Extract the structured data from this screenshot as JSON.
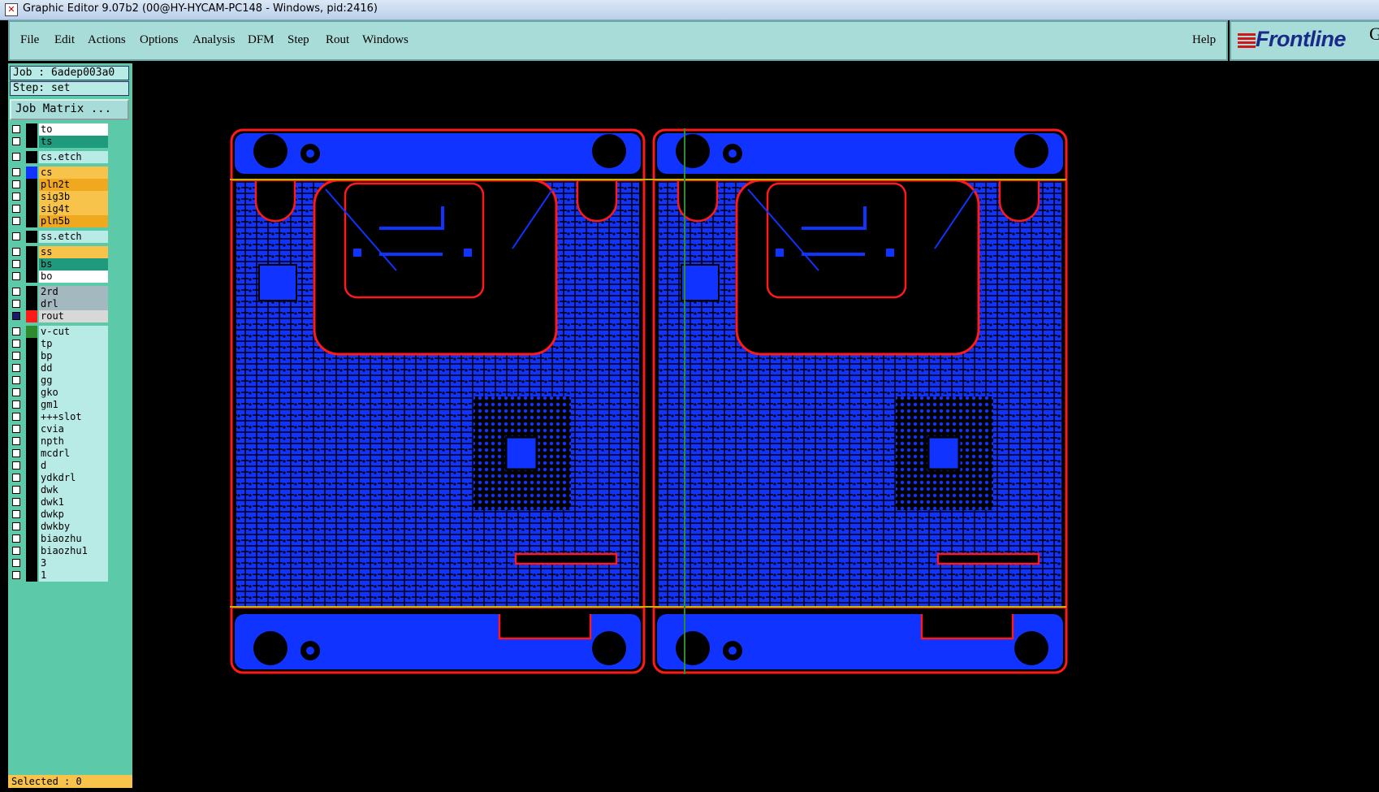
{
  "window": {
    "title": "Graphic Editor 9.07b2 (00@HY-HYCAM-PC148 - Windows, pid:2416)"
  },
  "menu": {
    "items": [
      "File",
      "Edit",
      "Actions",
      "Options",
      "Analysis",
      "DFM",
      "Step",
      "Rout",
      "Windows"
    ],
    "help": "Help"
  },
  "logo": {
    "brand": "Frontline",
    "trailing": "G"
  },
  "job": {
    "job_line": "Job : 6adep003a0",
    "step_line": "Step: set",
    "matrix_button": "Job Matrix ..."
  },
  "layers": [
    {
      "name": "to",
      "bg": "#ffffff",
      "swatch": "#000000"
    },
    {
      "name": "ts",
      "bg": "#1f9a7c",
      "swatch": "#000000"
    },
    {
      "name": "cs.etch",
      "bg": "#b8eae6",
      "swatch": "#000000"
    },
    {
      "name": "cs",
      "bg": "#f7c34a",
      "swatch": "#1033ff"
    },
    {
      "name": "pln2t",
      "bg": "#f0a81e",
      "swatch": "#000000"
    },
    {
      "name": "sig3b",
      "bg": "#f7c34a",
      "swatch": "#000000"
    },
    {
      "name": "sig4t",
      "bg": "#f7c34a",
      "swatch": "#000000"
    },
    {
      "name": "pln5b",
      "bg": "#f0a81e",
      "swatch": "#000000"
    },
    {
      "name": "ss.etch",
      "bg": "#b8eae6",
      "swatch": "#000000"
    },
    {
      "name": "ss",
      "bg": "#f7c34a",
      "swatch": "#000000"
    },
    {
      "name": "bs",
      "bg": "#1f9a7c",
      "swatch": "#000000"
    },
    {
      "name": "bo",
      "bg": "#ffffff",
      "swatch": "#000000"
    },
    {
      "name": "2rd",
      "bg": "#a4b8c0",
      "swatch": "#000000"
    },
    {
      "name": "drl",
      "bg": "#a4b8c0",
      "swatch": "#000000"
    },
    {
      "name": "rout",
      "bg": "#d8d8d8",
      "swatch": "#ff1a1a",
      "selected": true
    },
    {
      "name": "v-cut",
      "bg": "#b8eae6",
      "swatch": "#2e8b2e"
    },
    {
      "name": "tp",
      "bg": "#b8eae6",
      "swatch": "#000000"
    },
    {
      "name": "bp",
      "bg": "#b8eae6",
      "swatch": "#000000"
    },
    {
      "name": "dd",
      "bg": "#b8eae6",
      "swatch": "#000000"
    },
    {
      "name": "gg",
      "bg": "#b8eae6",
      "swatch": "#000000"
    },
    {
      "name": "gko",
      "bg": "#b8eae6",
      "swatch": "#000000"
    },
    {
      "name": "gm1",
      "bg": "#b8eae6",
      "swatch": "#000000"
    },
    {
      "name": "+++slot",
      "bg": "#b8eae6",
      "swatch": "#000000"
    },
    {
      "name": "cvia",
      "bg": "#b8eae6",
      "swatch": "#000000"
    },
    {
      "name": "npth",
      "bg": "#b8eae6",
      "swatch": "#000000"
    },
    {
      "name": "mcdrl",
      "bg": "#b8eae6",
      "swatch": "#000000"
    },
    {
      "name": "d",
      "bg": "#b8eae6",
      "swatch": "#000000"
    },
    {
      "name": "ydkdrl",
      "bg": "#b8eae6",
      "swatch": "#000000"
    },
    {
      "name": "dwk",
      "bg": "#b8eae6",
      "swatch": "#000000"
    },
    {
      "name": "dwk1",
      "bg": "#b8eae6",
      "swatch": "#000000"
    },
    {
      "name": "dwkp",
      "bg": "#b8eae6",
      "swatch": "#000000"
    },
    {
      "name": "dwkby",
      "bg": "#b8eae6",
      "swatch": "#000000"
    },
    {
      "name": "biaozhu",
      "bg": "#b8eae6",
      "swatch": "#000000"
    },
    {
      "name": "biaozhu1",
      "bg": "#b8eae6",
      "swatch": "#000000"
    },
    {
      "name": "3",
      "bg": "#b8eae6",
      "swatch": "#000000"
    },
    {
      "name": "1",
      "bg": "#b8eae6",
      "swatch": "#000000"
    }
  ],
  "status": {
    "selected": "Selected : 0"
  },
  "colors": {
    "copper": "#1033ff",
    "rout": "#ff1a1a",
    "vcut": "#c8b400",
    "background": "#000000"
  }
}
